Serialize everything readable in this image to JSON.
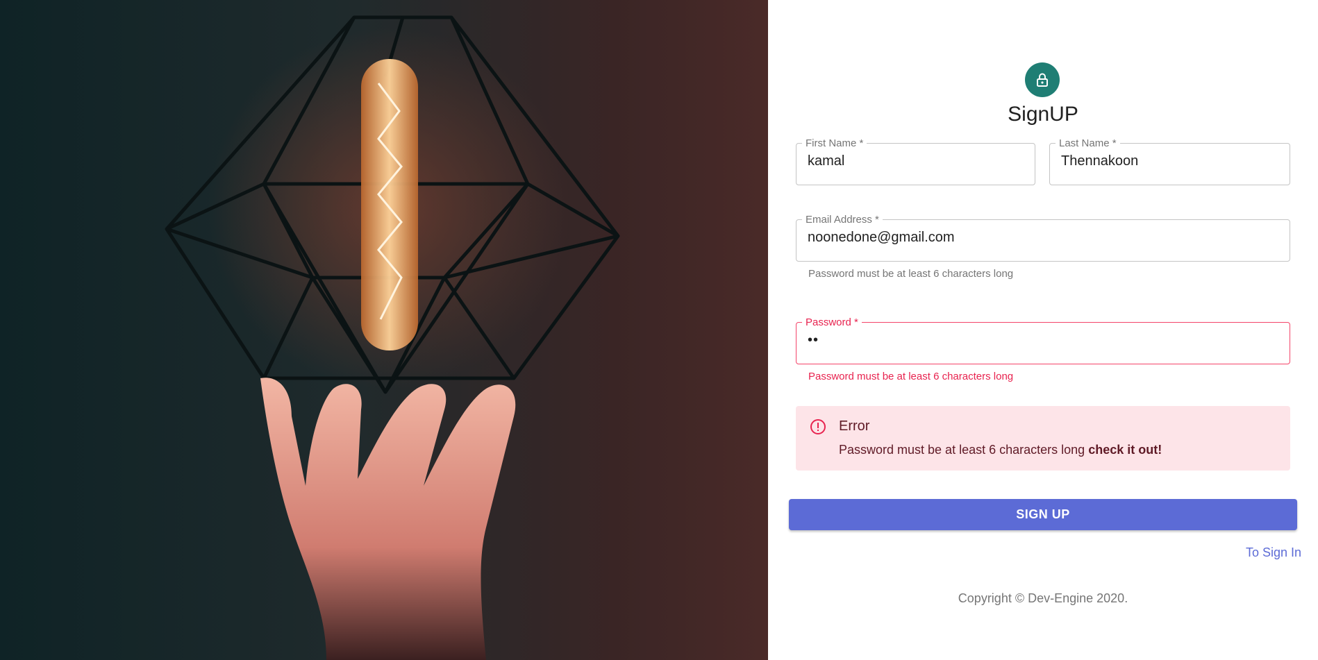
{
  "hero": {
    "image_icon": "lightbulb-cage-photo"
  },
  "form": {
    "avatar_icon": "lock-icon",
    "title": "SignUP",
    "first_name": {
      "label": "First Name *",
      "value": "kamal"
    },
    "last_name": {
      "label": "Last Name *",
      "value": "Thennakoon"
    },
    "email": {
      "label": "Email Address *",
      "value": "noonedone@gmail.com",
      "helper": "Password must be at least 6 characters long"
    },
    "password": {
      "label": "Password *",
      "value": "••",
      "helper": "Password must be at least 6 characters long"
    },
    "alert": {
      "title": "Error",
      "message": "Password must be at least 6 characters long",
      "emphasis": "check it out!",
      "icon": "error-outline-icon"
    },
    "submit_label": "SIGN UP",
    "signin_link": "To Sign In",
    "copyright": "Copyright © Dev-Engine 2020."
  },
  "colors": {
    "primary": "#5c6bd6",
    "avatar": "#1f7e74",
    "error": "#e8234f",
    "alert_bg": "#fde4e8"
  }
}
